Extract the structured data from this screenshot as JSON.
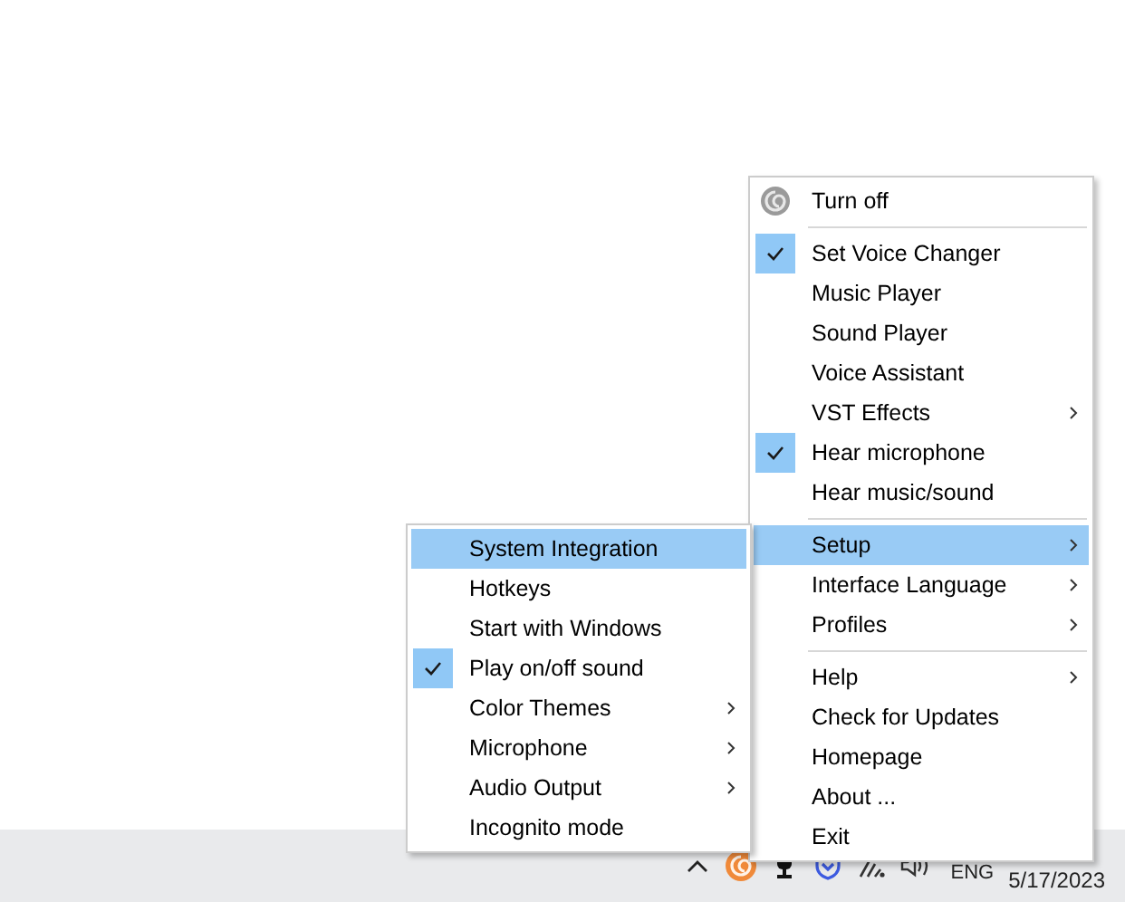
{
  "main_menu": {
    "sections": [
      [
        {
          "label": "Turn off",
          "checked": false,
          "submenu": false,
          "selected": false
        }
      ],
      [
        {
          "label": "Set Voice Changer",
          "checked": true,
          "submenu": false,
          "selected": false
        },
        {
          "label": "Music Player",
          "checked": false,
          "submenu": false,
          "selected": false
        },
        {
          "label": "Sound Player",
          "checked": false,
          "submenu": false,
          "selected": false
        },
        {
          "label": "Voice Assistant",
          "checked": false,
          "submenu": false,
          "selected": false
        },
        {
          "label": "VST Effects",
          "checked": false,
          "submenu": true,
          "selected": false
        },
        {
          "label": "Hear microphone",
          "checked": true,
          "submenu": false,
          "selected": false
        },
        {
          "label": "Hear music/sound",
          "checked": false,
          "submenu": false,
          "selected": false
        }
      ],
      [
        {
          "label": "Setup",
          "checked": false,
          "submenu": true,
          "selected": true
        },
        {
          "label": "Interface Language",
          "checked": false,
          "submenu": true,
          "selected": false
        },
        {
          "label": "Profiles",
          "checked": false,
          "submenu": true,
          "selected": false
        }
      ],
      [
        {
          "label": "Help",
          "checked": false,
          "submenu": true,
          "selected": false
        },
        {
          "label": "Check for Updates",
          "checked": false,
          "submenu": false,
          "selected": false
        },
        {
          "label": "Homepage",
          "checked": false,
          "submenu": false,
          "selected": false
        },
        {
          "label": "About ...",
          "checked": false,
          "submenu": false,
          "selected": false
        },
        {
          "label": "Exit",
          "checked": false,
          "submenu": false,
          "selected": false
        }
      ]
    ]
  },
  "setup_submenu": {
    "sections": [
      [
        {
          "label": "System Integration",
          "checked": false,
          "submenu": false,
          "selected": true
        },
        {
          "label": "Hotkeys",
          "checked": false,
          "submenu": false,
          "selected": false
        },
        {
          "label": "Start with Windows",
          "checked": false,
          "submenu": false,
          "selected": false
        },
        {
          "label": "Play on/off sound",
          "checked": true,
          "submenu": false,
          "selected": false
        },
        {
          "label": "Color Themes",
          "checked": false,
          "submenu": true,
          "selected": false
        },
        {
          "label": "Microphone",
          "checked": false,
          "submenu": true,
          "selected": false
        },
        {
          "label": "Audio Output",
          "checked": false,
          "submenu": true,
          "selected": false
        },
        {
          "label": "Incognito mode",
          "checked": false,
          "submenu": false,
          "selected": false
        }
      ]
    ]
  },
  "taskbar": {
    "language": "ENG",
    "date": "5/17/2023"
  }
}
